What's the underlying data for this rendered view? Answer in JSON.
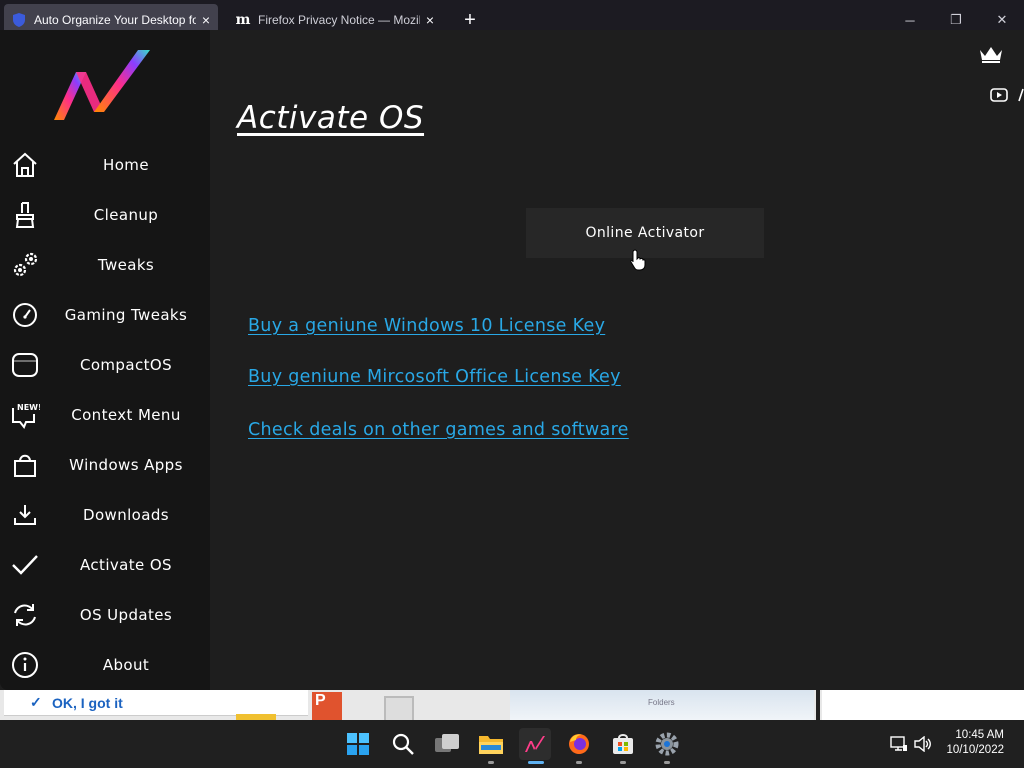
{
  "browser": {
    "tabs": [
      {
        "title": "Auto Organize Your Desktop fo",
        "icon": "shield-icon",
        "active": true
      },
      {
        "title": "Firefox Privacy Notice — Mozill",
        "icon": "mozilla-m-icon",
        "active": false
      }
    ],
    "new_tab_symbol": "+",
    "tab_close_symbol": "×",
    "window_controls": {
      "minimize": "─",
      "restore": "❐",
      "close": "✕"
    }
  },
  "sidebar": {
    "items": [
      {
        "label": "Home",
        "icon": "home-icon"
      },
      {
        "label": "Cleanup",
        "icon": "broom-icon"
      },
      {
        "label": "Tweaks",
        "icon": "gears-icon"
      },
      {
        "label": "Gaming Tweaks",
        "icon": "speedometer-icon"
      },
      {
        "label": "CompactOS",
        "icon": "compact-square-icon"
      },
      {
        "label": "Context Menu",
        "icon": "new-chat-bubble-icon"
      },
      {
        "label": "Windows Apps",
        "icon": "shopping-bag-icon"
      },
      {
        "label": "Downloads",
        "icon": "download-icon"
      },
      {
        "label": "Activate OS",
        "icon": "checkmark-icon"
      },
      {
        "label": "OS Updates",
        "icon": "refresh-icon"
      },
      {
        "label": "About",
        "icon": "info-icon"
      }
    ],
    "new_badge": "NEW!"
  },
  "main": {
    "title": "Activate OS",
    "online_activator_label": "Online Activator",
    "links": [
      "Buy a geniune Windows 10 License Key",
      "Buy geniune Mircosoft Office License Key",
      "Check deals on other games and software"
    ]
  },
  "peek": {
    "toast_text": "OK, I got it",
    "folders_text": "Folders"
  },
  "taskbar": {
    "icons": [
      "windows-start-icon",
      "search-icon",
      "task-view-icon",
      "file-explorer-icon",
      "optimizer-app-icon",
      "firefox-icon",
      "store-icon",
      "settings-icon"
    ],
    "time": "10:45 AM",
    "date": "10/10/2022"
  },
  "colors": {
    "link": "#29a8e6",
    "sidebar_bg": "#151515",
    "main_bg": "#1e1e1e",
    "button_bg": "#272727"
  }
}
